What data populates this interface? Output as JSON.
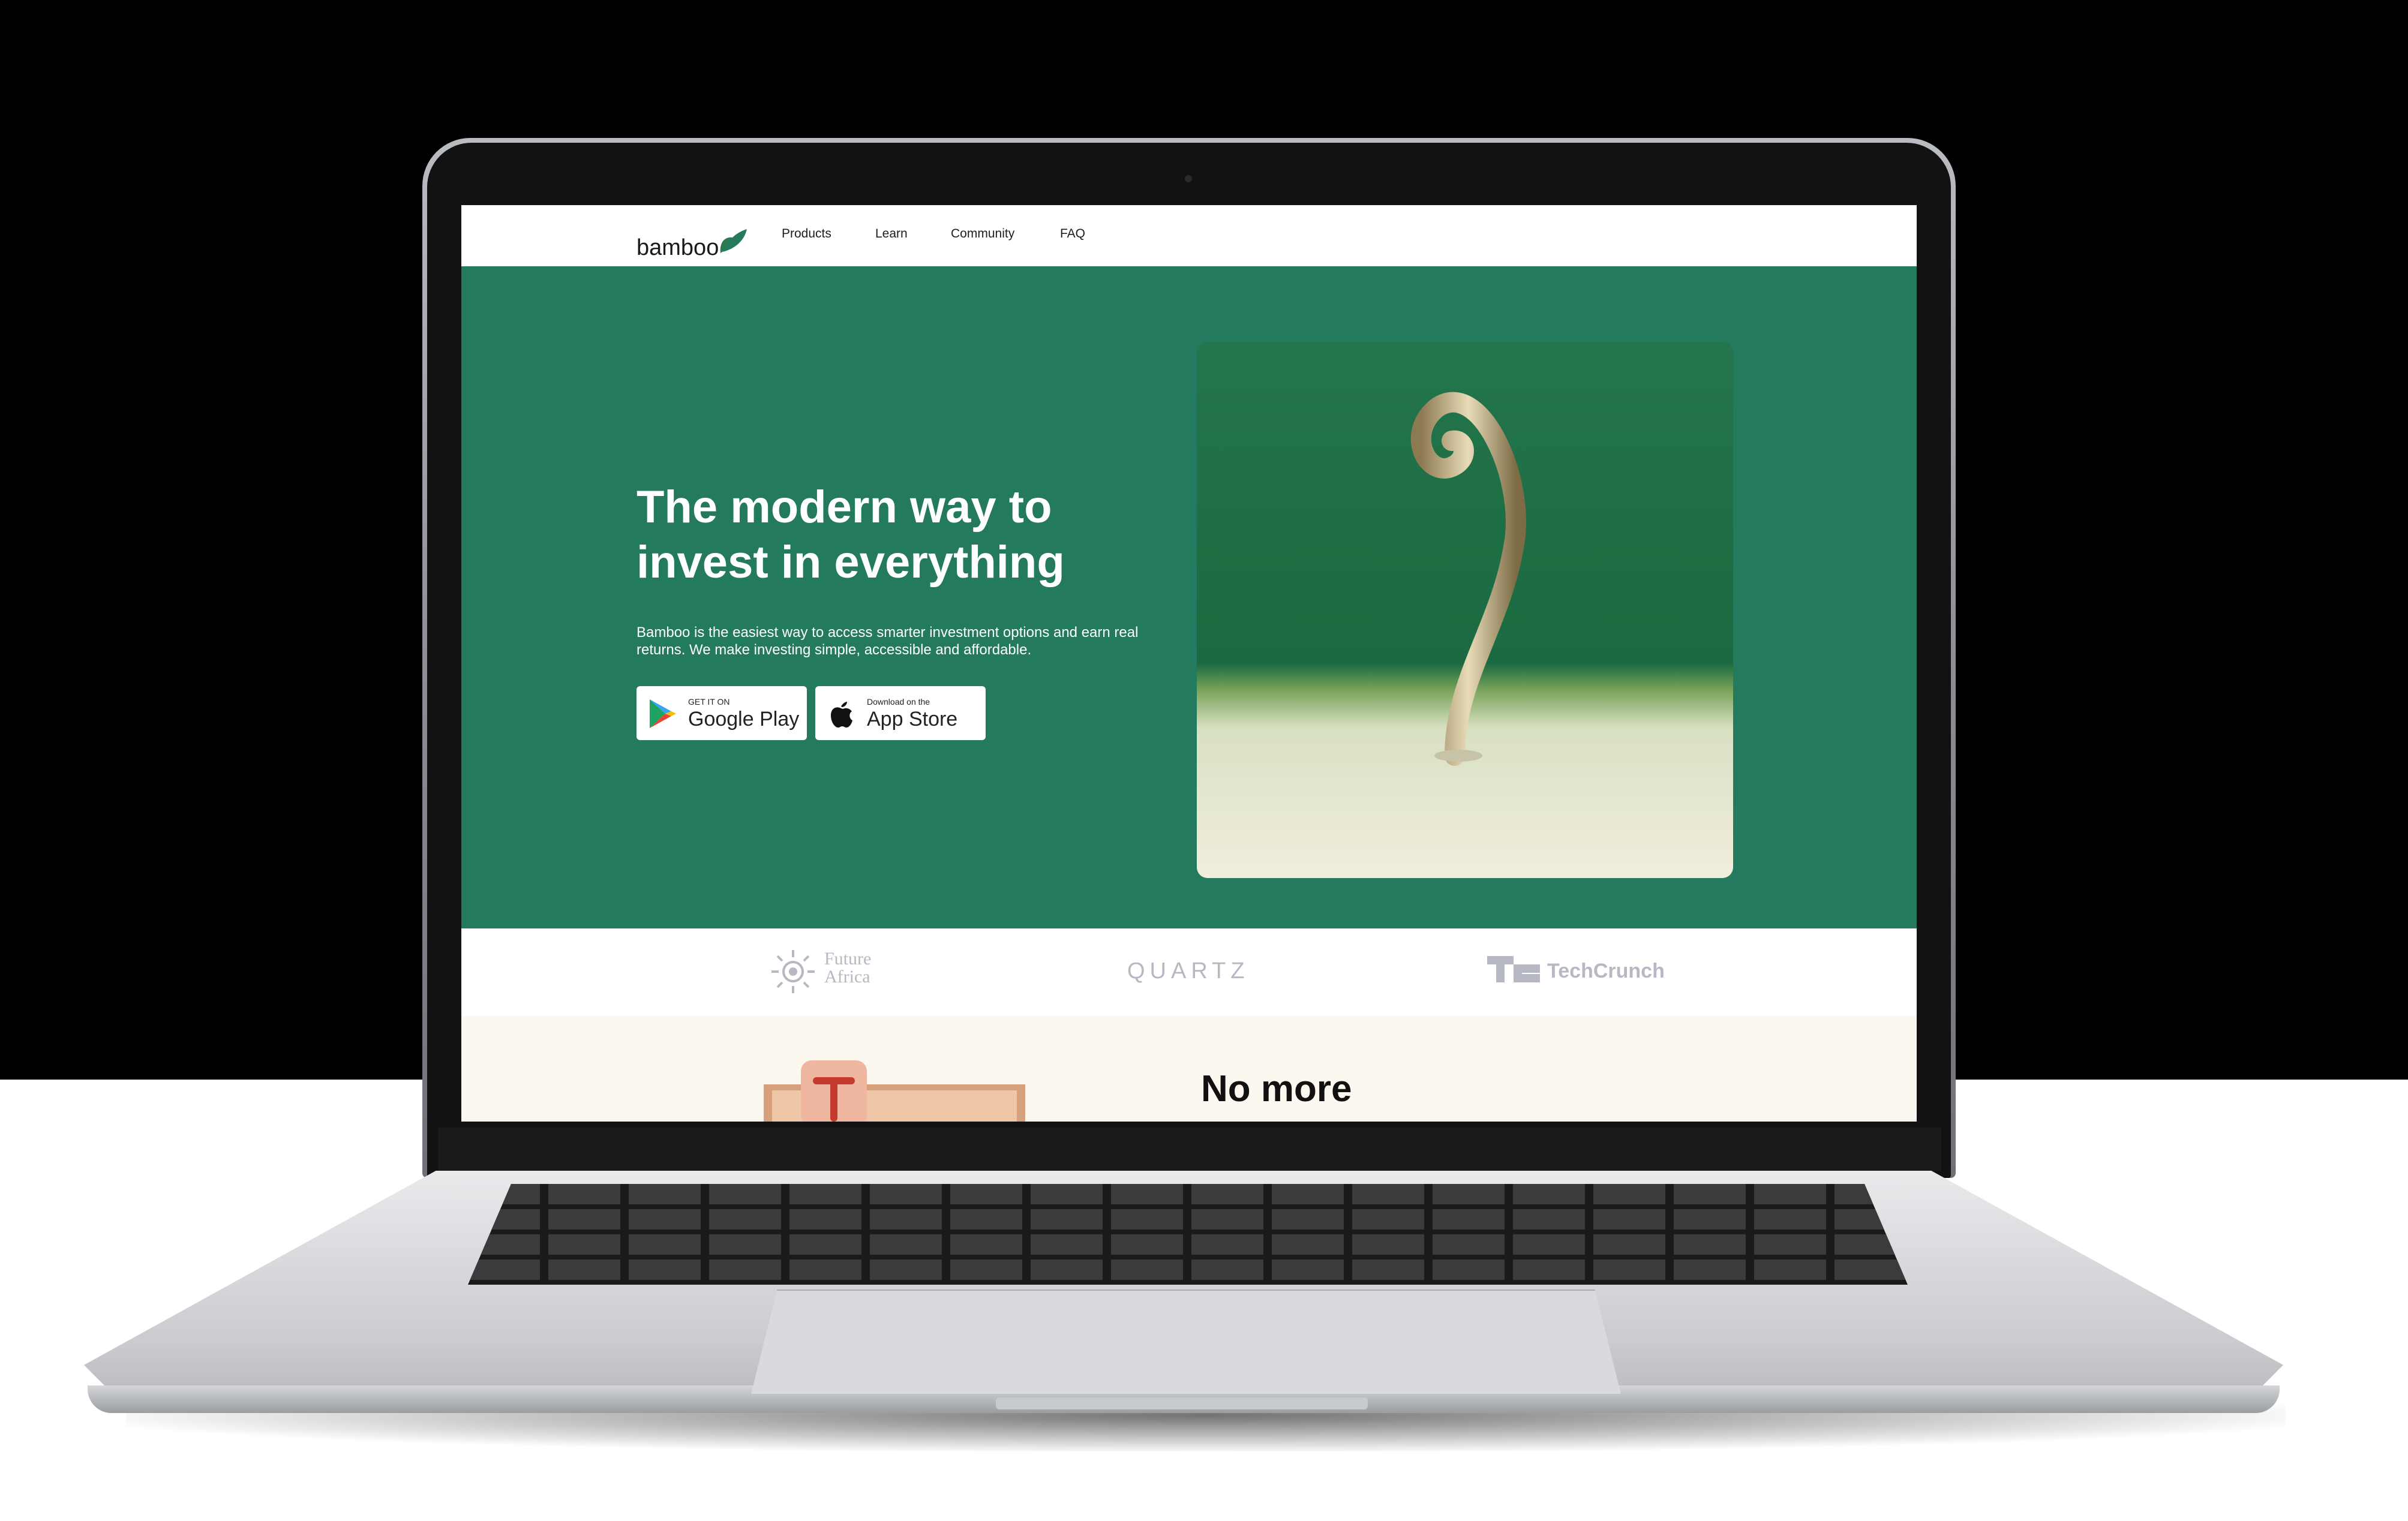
{
  "site": {
    "logo_text": "bamboo"
  },
  "nav": {
    "items": [
      "Products",
      "Learn",
      "Community",
      "FAQ"
    ]
  },
  "hero": {
    "title": "The modern way to invest in everything",
    "description": "Bamboo is the easiest way to access smarter investment options and earn real returns. We make investing simple, accessible and affordable.",
    "google_play": {
      "small": "GET IT ON",
      "big": "Google Play"
    },
    "app_store": {
      "small": "Download on the",
      "big": "App Store"
    }
  },
  "press": {
    "future_africa_line1": "Future",
    "future_africa_line2": "Africa",
    "quartz": "QUARTZ",
    "techcrunch": "TechCrunch"
  },
  "feature": {
    "title": "No more"
  },
  "colors": {
    "brand_green": "#237a5e",
    "leaf_green": "#2a7a4f",
    "press_gray": "#b6b9c3",
    "cream": "#fcf8ef"
  }
}
